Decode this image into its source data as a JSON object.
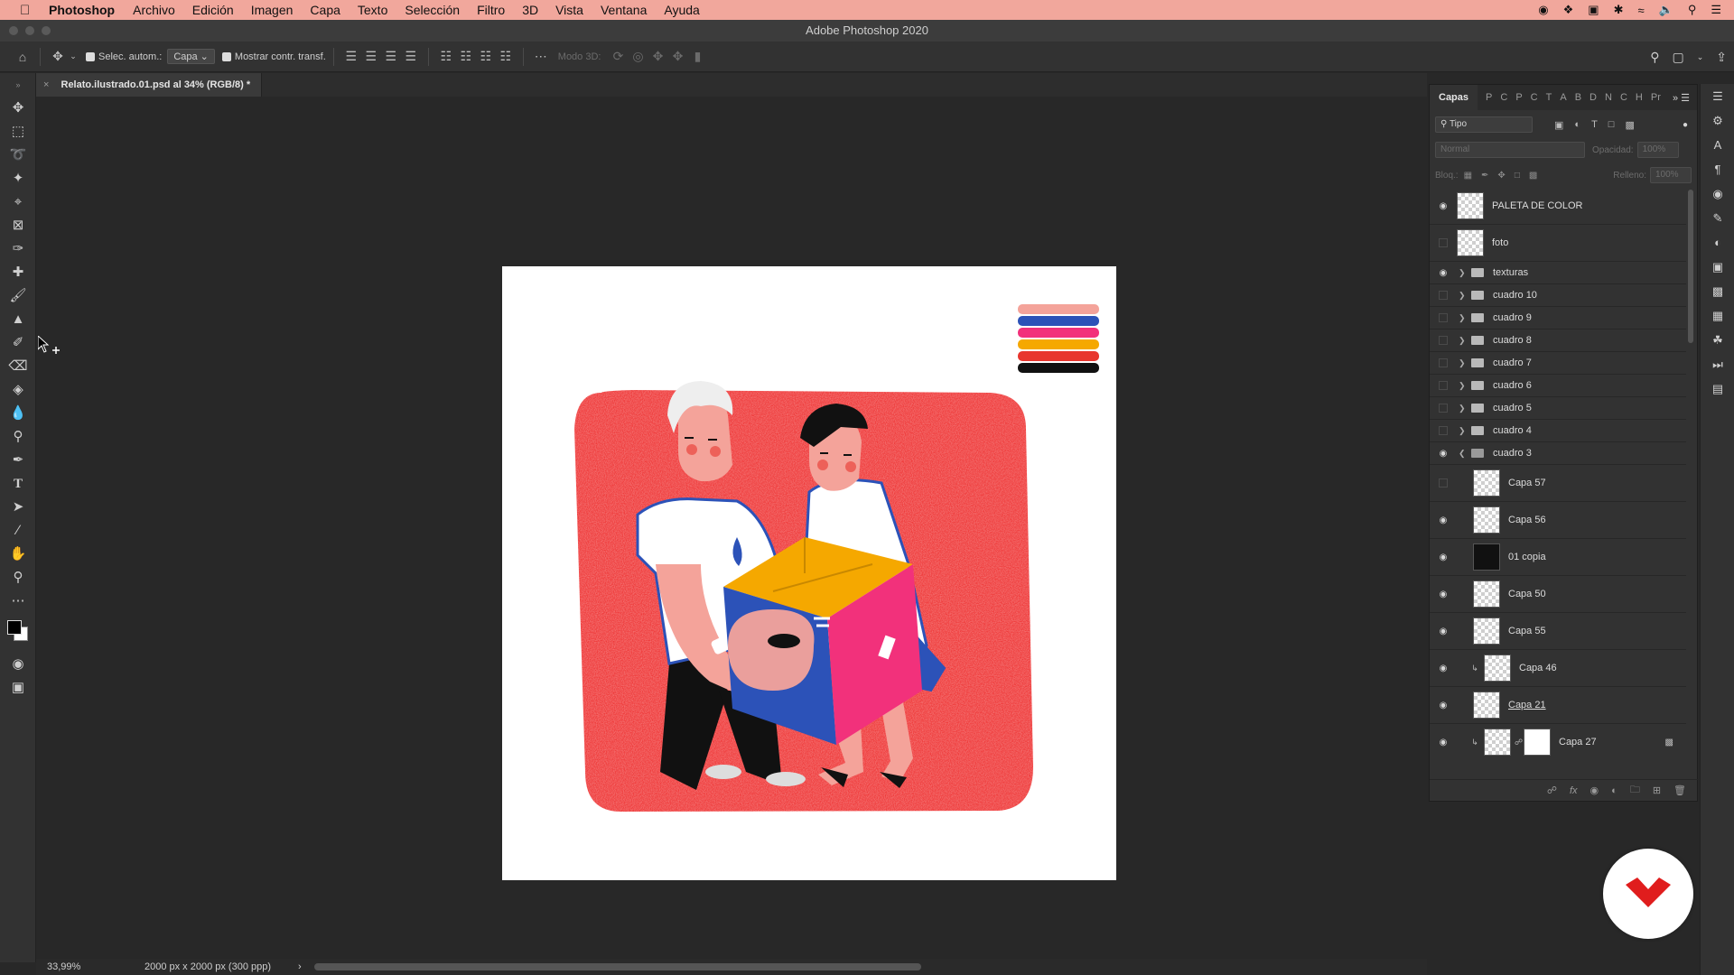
{
  "menubar": {
    "app_name": "Photoshop",
    "items": [
      "Archivo",
      "Edición",
      "Imagen",
      "Capa",
      "Texto",
      "Selección",
      "Filtro",
      "3D",
      "Vista",
      "Ventana",
      "Ayuda"
    ]
  },
  "window": {
    "title": "Adobe Photoshop 2020"
  },
  "options_bar": {
    "auto_select_label": "Selec. autom.:",
    "auto_select_target": "Capa",
    "show_transform_label": "Mostrar contr. transf.",
    "mode_3d_label": "Modo 3D:"
  },
  "document": {
    "tab_title": "Relato.ilustrado.01.psd al 34% (RGB/8) *",
    "zoom": "33,99%",
    "dimensions": "2000 px x 2000 px (300 ppp)"
  },
  "layers_panel": {
    "tab_label": "Capas",
    "other_tabs": [
      "P",
      "C",
      "P",
      "C",
      "T",
      "A",
      "B",
      "D",
      "N",
      "C",
      "H",
      "Pr"
    ],
    "filter_label": "Tipo",
    "blend_mode": "Normal",
    "opacity_label": "Opacidad:",
    "opacity_value": "100%",
    "lock_label": "Bloq.:",
    "fill_label": "Relleno:",
    "fill_value": "100%",
    "layers": [
      {
        "name": "PALETA DE COLOR",
        "kind": "layer",
        "visible": true
      },
      {
        "name": "foto",
        "kind": "layer",
        "visible": false
      },
      {
        "name": "texturas",
        "kind": "group",
        "visible": true
      },
      {
        "name": "cuadro 10",
        "kind": "group",
        "visible": false
      },
      {
        "name": "cuadro 9",
        "kind": "group",
        "visible": false
      },
      {
        "name": "cuadro 8",
        "kind": "group",
        "visible": false
      },
      {
        "name": "cuadro 7",
        "kind": "group",
        "visible": false
      },
      {
        "name": "cuadro 6",
        "kind": "group",
        "visible": false
      },
      {
        "name": "cuadro 5",
        "kind": "group",
        "visible": false
      },
      {
        "name": "cuadro 4",
        "kind": "group",
        "visible": false
      },
      {
        "name": "cuadro 3",
        "kind": "group-open",
        "visible": true
      },
      {
        "name": "Capa 57",
        "kind": "child",
        "visible": false
      },
      {
        "name": "Capa 56",
        "kind": "child",
        "visible": true
      },
      {
        "name": "01 copia",
        "kind": "child-dark",
        "visible": true
      },
      {
        "name": "Capa 50",
        "kind": "child",
        "visible": true
      },
      {
        "name": "Capa 55",
        "kind": "child",
        "visible": true
      },
      {
        "name": "Capa 46",
        "kind": "child-clip",
        "visible": true
      },
      {
        "name": "Capa 21",
        "kind": "child-underline",
        "visible": true
      },
      {
        "name": "Capa 27",
        "kind": "child-mask",
        "visible": true
      }
    ]
  },
  "colors": {
    "menubar_bg": "#f1a79c",
    "art_red": "#ef3b3b",
    "palette": [
      "#f4a39a",
      "#2c52b8",
      "#f2317b",
      "#f5a800",
      "#e8362e",
      "#111111"
    ]
  }
}
